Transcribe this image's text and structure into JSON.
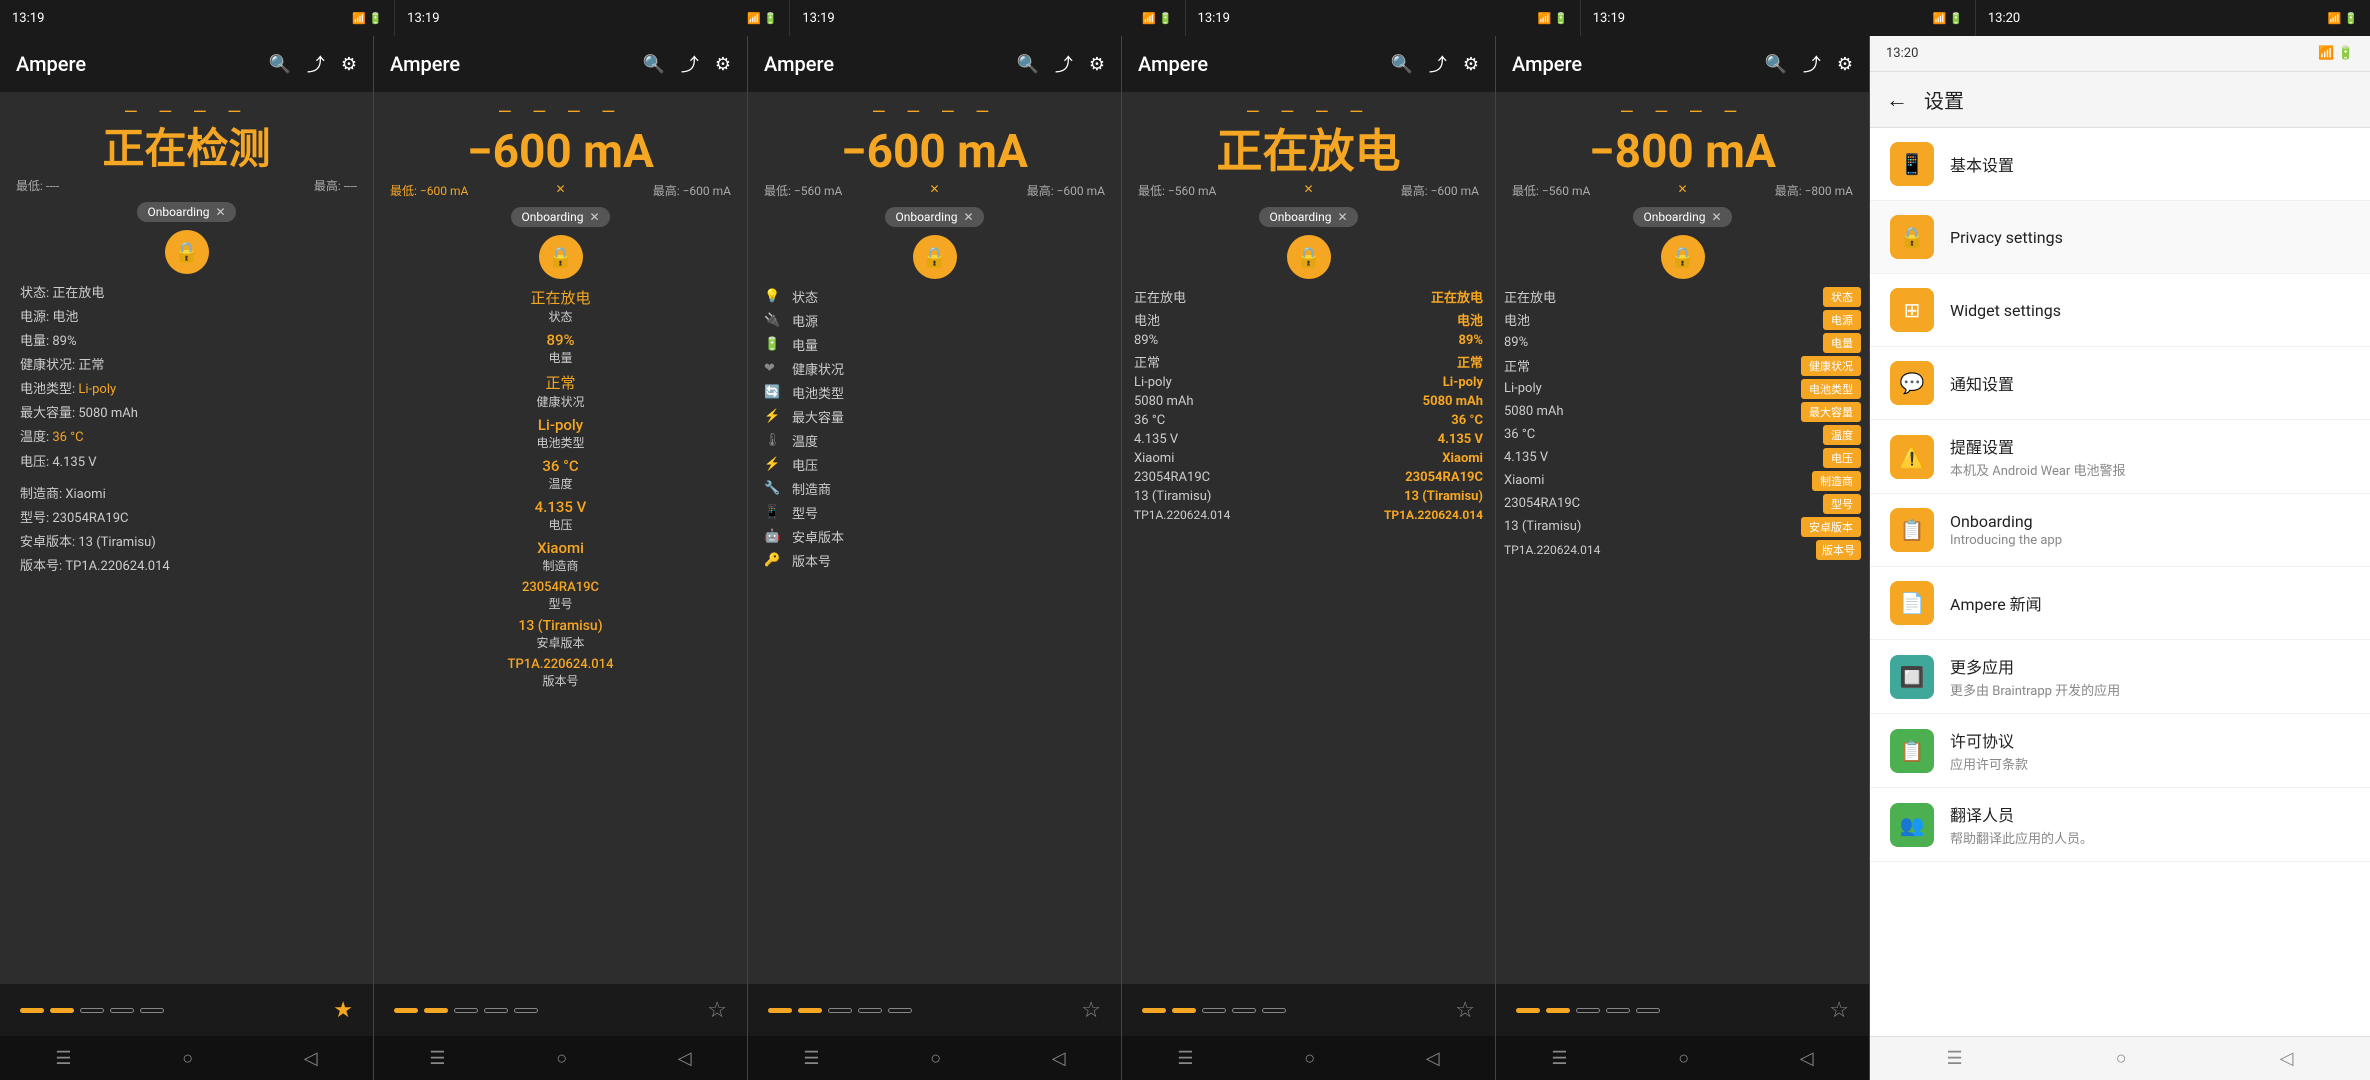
{
  "statusBars": [
    {
      "time": "13:19",
      "icons": "📶 WiFi 🔋89"
    },
    {
      "time": "13:19",
      "icons": "📶 WiFi 🔋89"
    },
    {
      "time": "13:19",
      "icons": "📶 WiFi 🔋89"
    },
    {
      "time": "13:19",
      "icons": "📶 WiFi 🔋89"
    },
    {
      "time": "13:19",
      "icons": "📶 WiFi 🔋89"
    },
    {
      "time": "13:20",
      "icons": "📶 WiFi 🔋89"
    }
  ],
  "appTitle": "Ampere",
  "settingsTitle": "设置",
  "panels": [
    {
      "id": "panel1",
      "mainValue": "正在检测",
      "mainColor": "orange",
      "subMin": "最低: ----",
      "subMax": "最高: ----",
      "status": "正在放电",
      "source": "电源: 电池",
      "battery": "电量: 89%",
      "health": "健康状况: 正常",
      "type": "电池类型: Li-poly",
      "capacity": "最大容量: 5080 mAh",
      "temp": "温度: 36 °C",
      "voltage": "电压: 4.135 V",
      "brand": "制造商: Xiaomi",
      "model": "型号: 23054RA19C",
      "android": "安卓版本: 13 (Tiramisu)",
      "build": "版本号: TP1A.220624.014",
      "dots": [
        "active",
        "active",
        "inactive",
        "inactive",
        "inactive"
      ],
      "star": "empty",
      "style": "style1"
    },
    {
      "id": "panel2",
      "mainValue": "−600 mA",
      "mainColor": "orange",
      "subMin": "最低: −600 mA",
      "subMax": "最高: −600 mA",
      "col1val": "正在放电",
      "col1lbl": "状态",
      "col2val": "89%",
      "col2lbl": "电量",
      "col3val": "Li-poly",
      "col3lbl": "电池类型",
      "col4val": "36 °C",
      "col4lbl": "温度",
      "col5val": "Xiaomi",
      "col5lbl": "制造商",
      "col6val": "13 (Tiramisu)",
      "col6lbl": "安卓版本",
      "col7val": "正常",
      "col7lbl": "健康状况",
      "col8val": "5080 mAh",
      "col8lbl": "最大容量",
      "col9val": "23054RA19C",
      "col9lbl": "型号",
      "col10val": "TP1A.220624.014",
      "col10lbl": "版本号",
      "dots": [
        "active",
        "active",
        "inactive",
        "inactive",
        "inactive"
      ],
      "star": "empty",
      "style": "style2"
    },
    {
      "id": "panel3",
      "mainValue": "−600 mA",
      "mainColor": "orange",
      "subMin": "最低: −560 mA",
      "subMax": "最高: −600 mA",
      "rows": [
        {
          "icon": "💡",
          "label": "状态"
        },
        {
          "icon": "🔌",
          "label": "电源"
        },
        {
          "icon": "🔋",
          "label": "电量"
        },
        {
          "icon": "❤️",
          "label": "健康状况"
        },
        {
          "icon": "🔄",
          "label": "电池类型"
        },
        {
          "icon": "⚡",
          "label": "最大容量"
        },
        {
          "icon": "🌡️",
          "label": "温度"
        },
        {
          "icon": "⚡",
          "label": "电压"
        },
        {
          "icon": "🔧",
          "label": "制造商"
        },
        {
          "icon": "📱",
          "label": "型号"
        },
        {
          "icon": "🤖",
          "label": "安卓版本"
        },
        {
          "icon": "🔑",
          "label": "版本号"
        }
      ],
      "dots": [
        "active",
        "active",
        "inactive",
        "inactive",
        "inactive"
      ],
      "star": "empty",
      "style": "style3"
    },
    {
      "id": "panel4",
      "mainValue": "正在放电",
      "mainColor": "orange",
      "subMin": "最低: −560 mA",
      "subMax": "最高: −600 mA",
      "rightValues": [
        {
          "label": "正在放电",
          "bold": true
        },
        {
          "label": "电池",
          "bold": true
        },
        {
          "label": "89%",
          "bold": true
        },
        {
          "label": "正常",
          "bold": true
        },
        {
          "label": "Li-poly",
          "bold": true
        },
        {
          "label": "5080 mAh",
          "bold": true
        },
        {
          "label": "36 °C",
          "bold": true
        },
        {
          "label": "4.135 V",
          "bold": true
        },
        {
          "label": "Xiaomi",
          "bold": true
        },
        {
          "label": "23054RA19C",
          "bold": true
        },
        {
          "label": "13 (Tiramisu)",
          "bold": true
        },
        {
          "label": "TP1A.220624.014",
          "bold": true
        }
      ],
      "dots": [
        "active",
        "active",
        "inactive",
        "inactive",
        "inactive"
      ],
      "star": "empty",
      "style": "style4a"
    },
    {
      "id": "panel5",
      "mainValue": "−800 mA",
      "mainColor": "orange",
      "subMin": "最低: −560 mA",
      "subMax": "最高: −800 mA",
      "leftLabels": [
        "正在放电",
        "电池",
        "89%",
        "正常",
        "Li-poly",
        "5080 mAh",
        "36 °C",
        "4.135 V",
        "Xiaomi",
        "23054RA19C",
        "13 (Tiramisu)",
        "TP1A.220624.014"
      ],
      "rightBadges": [
        "状态",
        "电源",
        "电量",
        "健康状况",
        "电池类型",
        "最大容量",
        "温度",
        "电压",
        "制造商",
        "型号",
        "安卓版本",
        "版本号"
      ],
      "dots": [
        "active",
        "active",
        "inactive",
        "inactive",
        "inactive"
      ],
      "star": "empty",
      "style": "style4b"
    }
  ],
  "settings": {
    "title": "设置",
    "backLabel": "←",
    "items": [
      {
        "id": "basic",
        "icon": "📱",
        "color": "#f5a623",
        "title": "基本设置",
        "sub": ""
      },
      {
        "id": "privacy",
        "icon": "🔒",
        "color": "#f5a623",
        "title": "Privacy settings",
        "sub": ""
      },
      {
        "id": "widget",
        "icon": "⊞",
        "color": "#f5a623",
        "title": "Widget settings",
        "sub": ""
      },
      {
        "id": "notify",
        "icon": "💬",
        "color": "#f5a623",
        "title": "通知设置",
        "sub": ""
      },
      {
        "id": "remind",
        "icon": "⚠️",
        "color": "#f5a623",
        "title": "提醒设置",
        "sub": "本机及 Android Wear 电池警报"
      },
      {
        "id": "onboarding",
        "icon": "📋",
        "color": "#f5a623",
        "title": "Onboarding",
        "sub": "Introducing the app"
      },
      {
        "id": "news",
        "icon": "📄",
        "color": "#f5a623",
        "title": "Ampere 新闻",
        "sub": ""
      },
      {
        "id": "more",
        "icon": "🔲",
        "color": "#4caf93",
        "title": "更多应用",
        "sub": "更多由 Braintrapp 开发的应用"
      },
      {
        "id": "license",
        "icon": "📋",
        "color": "#4caf50",
        "title": "许可协议",
        "sub": "应用许可条款"
      },
      {
        "id": "translate",
        "icon": "👥",
        "color": "#4caf50",
        "title": "翻译人员",
        "sub": "帮助翻译此应用的人员。"
      }
    ]
  },
  "navIcons": [
    "☰",
    "○",
    "◁"
  ]
}
